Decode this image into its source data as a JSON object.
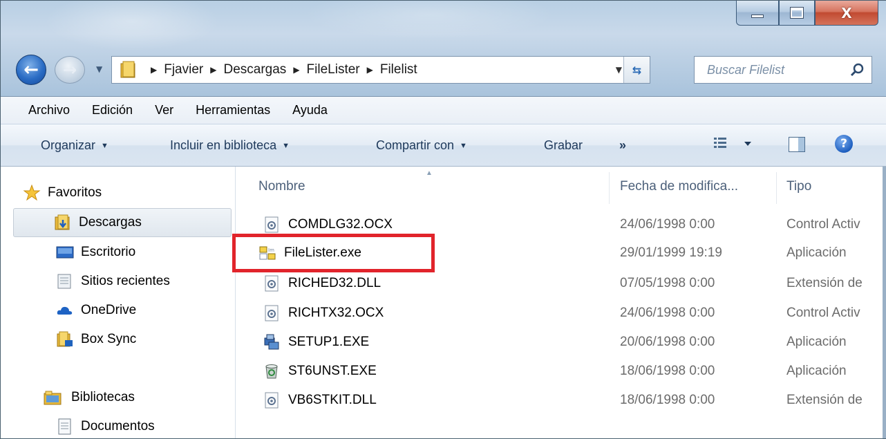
{
  "window": {
    "controls": {
      "minimize": "minimize",
      "maximize": "maximize",
      "close": "X"
    }
  },
  "address_bar": {
    "breadcrumbs": [
      "Fjavier",
      "Descargas",
      "FileLister",
      "Filelist"
    ]
  },
  "search": {
    "placeholder": "Buscar Filelist"
  },
  "menubar": {
    "items": [
      "Archivo",
      "Edición",
      "Ver",
      "Herramientas",
      "Ayuda"
    ]
  },
  "commandbar": {
    "organize": "Organizar",
    "include_library": "Incluir en biblioteca",
    "share_with": "Compartir con",
    "burn": "Grabar",
    "more": "»"
  },
  "navigation": {
    "favorites_header": "Favoritos",
    "favorites": [
      {
        "label": "Descargas",
        "icon": "downloads-folder-icon",
        "selected": true
      },
      {
        "label": "Escritorio",
        "icon": "desktop-icon",
        "selected": false
      },
      {
        "label": "Sitios recientes",
        "icon": "recent-places-icon",
        "selected": false
      },
      {
        "label": "OneDrive",
        "icon": "onedrive-icon",
        "selected": false
      },
      {
        "label": "Box Sync",
        "icon": "box-sync-icon",
        "selected": false
      }
    ],
    "libraries_header": "Bibliotecas",
    "libraries": [
      {
        "label": "Documentos",
        "icon": "documents-icon"
      }
    ]
  },
  "file_list": {
    "columns": {
      "name": "Nombre",
      "date": "Fecha de modifica...",
      "type": "Tipo"
    },
    "files": [
      {
        "name": "COMDLG32.OCX",
        "date": "24/06/1998 0:00",
        "type": "Control Activ",
        "icon": "system-file-icon"
      },
      {
        "name": "FileLister.exe",
        "date": "29/01/1999 19:19",
        "type": "Aplicación",
        "icon": "application-icon"
      },
      {
        "name": "RICHED32.DLL",
        "date": "07/05/1998 0:00",
        "type": "Extensión de",
        "icon": "system-file-icon"
      },
      {
        "name": "RICHTX32.OCX",
        "date": "24/06/1998 0:00",
        "type": "Control Activ",
        "icon": "system-file-icon"
      },
      {
        "name": "SETUP1.EXE",
        "date": "20/06/1998 0:00",
        "type": "Aplicación",
        "icon": "setup-icon"
      },
      {
        "name": "ST6UNST.EXE",
        "date": "18/06/1998 0:00",
        "type": "Aplicación",
        "icon": "recycle-icon"
      },
      {
        "name": "VB6STKIT.DLL",
        "date": "18/06/1998 0:00",
        "type": "Extensión de",
        "icon": "system-file-icon"
      }
    ]
  },
  "colors": {
    "highlight_box": "#e1242b",
    "accent": "#1e5fc0"
  }
}
